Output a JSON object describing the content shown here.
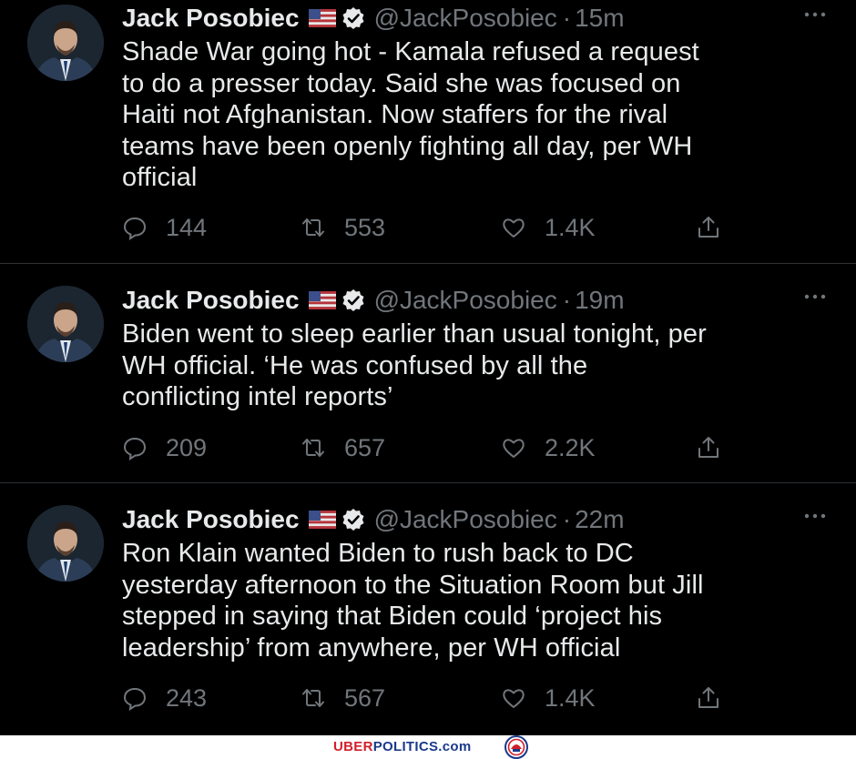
{
  "colors": {
    "background": "#000000",
    "text": "#e7e9ea",
    "muted": "#71767b",
    "divider": "#2f3336",
    "brand_red": "#d21f2b",
    "brand_blue": "#1b3a8a"
  },
  "icons": {
    "reply": "speech-bubble-icon",
    "retweet": "retweet-icon",
    "like": "heart-icon",
    "share": "share-icon",
    "verified": "verified-badge-icon",
    "flag": "us-flag-icon",
    "more": "more-dots-icon"
  },
  "tweets": [
    {
      "name": "Jack Posobiec",
      "handle": "@JackPosobiec",
      "dot": "·",
      "time": "15m",
      "lines": [
        "Shade War going hot - Kamala refused a request",
        "to do a presser today. Said she was focused on",
        "Haiti not Afghanistan. Now staffers for the rival",
        "teams have been openly fighting all day, per WH",
        "official"
      ],
      "replies": "144",
      "retweets": "553",
      "likes": "1.4K"
    },
    {
      "name": "Jack Posobiec",
      "handle": "@JackPosobiec",
      "dot": "·",
      "time": "19m",
      "lines": [
        "Biden went to sleep earlier than usual tonight, per",
        "WH official. ‘He was confused by all the",
        "conflicting intel reports’"
      ],
      "replies": "209",
      "retweets": "657",
      "likes": "2.2K"
    },
    {
      "name": "Jack Posobiec",
      "handle": "@JackPosobiec",
      "dot": "·",
      "time": "22m",
      "lines": [
        "Ron Klain wanted Biden to rush back to DC",
        "yesterday afternoon to the Situation Room but Jill",
        "stepped in saying that Biden could ‘project his",
        "leadership’ from anywhere, per WH official"
      ],
      "replies": "243",
      "retweets": "567",
      "likes": "1.4K"
    }
  ],
  "footer": {
    "brand_part1": "UBER",
    "brand_part2": "POLITICS.com"
  }
}
